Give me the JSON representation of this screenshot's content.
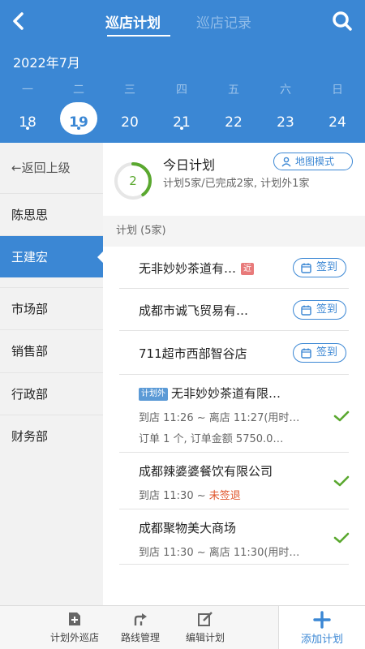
{
  "header": {
    "tabs": [
      {
        "label": "巡店计划",
        "active": true
      },
      {
        "label": "巡店记录",
        "active": false
      }
    ],
    "month": "2022年7月",
    "week": [
      {
        "weekday": "一",
        "date": "18",
        "dot": true
      },
      {
        "weekday": "二",
        "date": "19",
        "dot": true,
        "selected": true
      },
      {
        "weekday": "三",
        "date": "20",
        "dot": false
      },
      {
        "weekday": "四",
        "date": "21",
        "dot": true
      },
      {
        "weekday": "五",
        "date": "22",
        "dot": false
      },
      {
        "weekday": "六",
        "date": "23",
        "dot": false
      },
      {
        "weekday": "日",
        "date": "24",
        "dot": false
      }
    ],
    "back_icon": "chevron-left-icon",
    "search_icon": "search-icon"
  },
  "sidebar": {
    "back_label": "←返回上级",
    "items": [
      {
        "label": "陈思思"
      },
      {
        "label": "王建宏",
        "selected": true
      },
      {
        "label": "市场部"
      },
      {
        "label": "销售部"
      },
      {
        "label": "行政部"
      },
      {
        "label": "财务部"
      }
    ]
  },
  "today": {
    "title": "今日计划",
    "completed_count": "2",
    "progress": 0.4,
    "summary": "计划5家/已完成2家, 计划外1家",
    "map_button": "地图模式"
  },
  "plan": {
    "header": "计划 (5家)",
    "rows": [
      {
        "name": "无非妙妙茶道有…",
        "tag": "近",
        "action": "签到"
      },
      {
        "name": "成都市诚飞贸易有…",
        "action": "签到"
      },
      {
        "name": "711超市西部智谷店",
        "action": "签到"
      },
      {
        "name": "无非妙妙茶道有限…",
        "tag": "计划外",
        "visit": "到店 11:26 ~ 离店 11:27(用时…",
        "order": "订单 1 个, 订单金额 5750.0…",
        "done": true
      },
      {
        "name": "成都辣婆婆餐饮有限公司",
        "visit_prefix": "到店 11:30 ~ ",
        "visit_status": "未签退",
        "done": true
      },
      {
        "name": "成都聚物美大商场",
        "visit": "到店 11:30 ~ 离店 11:30(用时…",
        "done": true
      }
    ]
  },
  "bottombar": {
    "items": [
      {
        "label": "计划外巡店",
        "icon": "plus-square-icon"
      },
      {
        "label": "路线管理",
        "icon": "route-icon"
      },
      {
        "label": "编辑计划",
        "icon": "edit-icon"
      }
    ],
    "add_label": "添加计划"
  },
  "colors": {
    "primary": "#3b87d4",
    "success": "#5aa82f",
    "warning": "#e0582f",
    "near_tag": "#e87a7a"
  }
}
